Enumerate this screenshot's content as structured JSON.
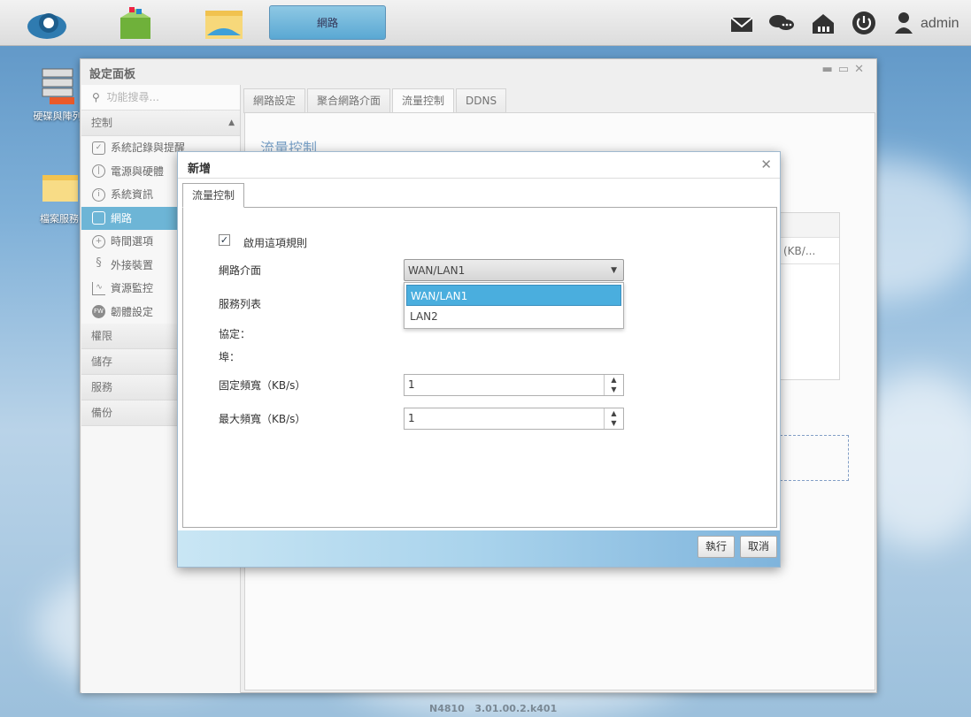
{
  "topbar": {
    "active_tab": "網路",
    "user": "admin",
    "icons": [
      "cloud-icon",
      "app-center-icon",
      "file-manager-icon",
      "mail-icon",
      "chat-icon",
      "network-map-icon",
      "power-icon",
      "user-icon"
    ]
  },
  "desktop": {
    "icons": [
      {
        "label": "硬碟與陣列",
        "icon": "storage-icon"
      },
      {
        "label": "檔案服務",
        "icon": "folder-icon"
      }
    ]
  },
  "settings_window": {
    "title": "設定面板",
    "search_placeholder": "功能搜尋...",
    "sections": {
      "control": "控制",
      "permissions": "權限",
      "storage": "儲存",
      "services": "服務",
      "backup": "備份"
    },
    "nav_items": [
      {
        "label": "系統記錄與提醒",
        "icon": "log-icon"
      },
      {
        "label": "電源與硬體",
        "icon": "power-icon"
      },
      {
        "label": "系統資訊",
        "icon": "info-icon"
      },
      {
        "label": "網路",
        "icon": "network-icon",
        "active": true
      },
      {
        "label": "時間選項",
        "icon": "globe-icon"
      },
      {
        "label": "外接裝置",
        "icon": "usb-icon"
      },
      {
        "label": "資源監控",
        "icon": "monitor-chart-icon"
      },
      {
        "label": "韌體設定",
        "icon": "firmware-icon"
      }
    ],
    "tabs": [
      "網路設定",
      "聚合網路介面",
      "流量控制",
      "DDNS"
    ],
    "active_tab": "流量控制",
    "content_title": "流量控制",
    "table_partial_header": "(KB/..."
  },
  "dialog": {
    "title": "新增",
    "tab": "流量控制",
    "enable_rule_label": "啟用這項規則",
    "enable_rule_checked": true,
    "interface_label": "網路介面",
    "interface_value": "WAN/LAN1",
    "interface_options": [
      "WAN/LAN1",
      "LAN2"
    ],
    "service_list_label": "服務列表",
    "protocol_label": "協定：",
    "port_label": "埠：",
    "fixed_bandwidth_label": "固定頻寬（KB/s）",
    "fixed_bandwidth_value": "1",
    "max_bandwidth_label": "最大頻寬（KB/s）",
    "max_bandwidth_value": "1",
    "execute_button": "執行",
    "cancel_button": "取消"
  },
  "footer": {
    "model": "N4810",
    "version": "3.01.00.2.k401"
  }
}
